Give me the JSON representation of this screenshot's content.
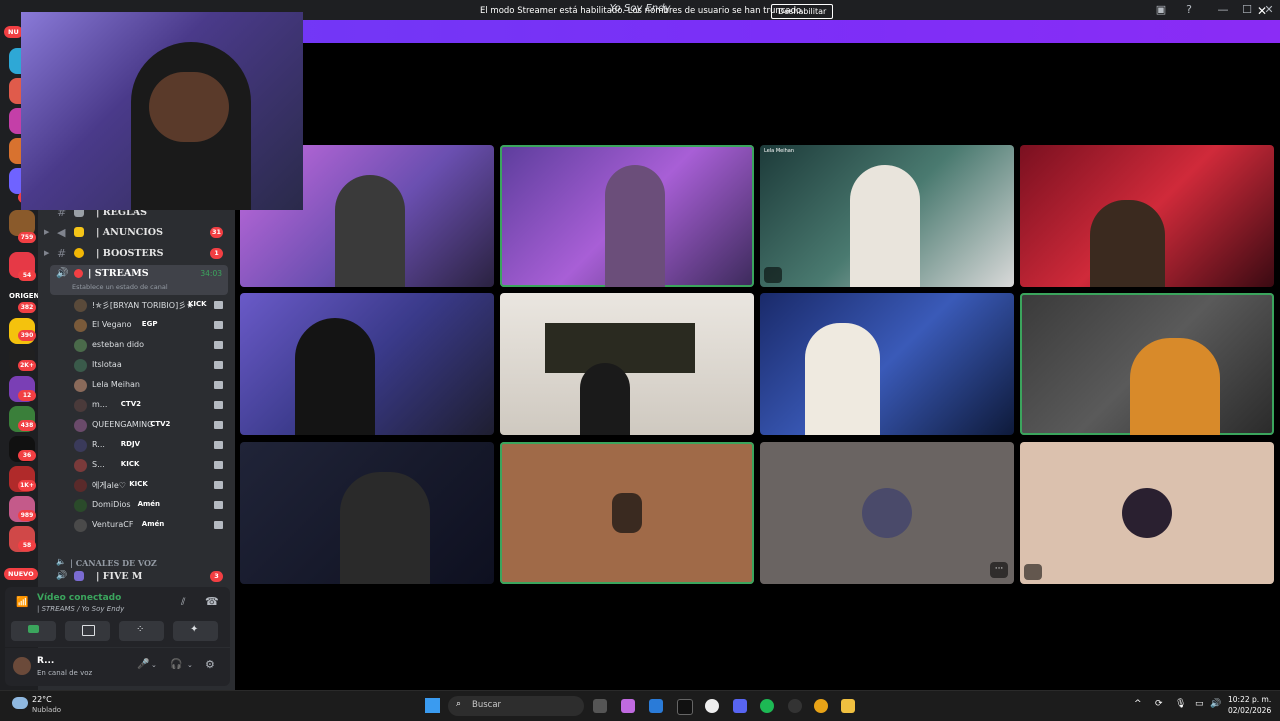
{
  "window": {
    "title": "Yo Soy Endy",
    "controls": [
      "—",
      "☐",
      "✕"
    ]
  },
  "banner": {
    "text": "El modo Streamer está habilitado. Los nombres de usuario se han truncado.",
    "button": "Deshabilitar",
    "close": "✕"
  },
  "rail": {
    "top_label": "NU",
    "badges": [
      "18",
      "759",
      "54",
      "382",
      "390",
      "2K+",
      "12",
      "438",
      "36",
      "1K+",
      "989",
      "58"
    ],
    "bottom_label": "NUEVO",
    "server_text": "ORIGEN"
  },
  "channels": [
    {
      "icon": "📋",
      "name": "| REGLAS",
      "badge": ""
    },
    {
      "icon": "🔔",
      "name": "| ANUNCIOS",
      "badge": "31"
    },
    {
      "icon": "🌟",
      "name": "| BOOSTERS",
      "badge": "1"
    }
  ],
  "streams_channel": {
    "name": "| STREAMS",
    "time": "34:03",
    "status": "Establece un estado de canal"
  },
  "users": [
    {
      "name": "!✯彡[BRYAN TORIBIO]彡★",
      "tag": "KICK",
      "tag_color": "#53fc18"
    },
    {
      "name": "El Vegano",
      "tag": "EGP",
      "tag_color": "#ff6b8a"
    },
    {
      "name": "esteban dido",
      "tag": "",
      "tag_color": ""
    },
    {
      "name": "Itslotaa",
      "tag": "",
      "tag_color": ""
    },
    {
      "name": "Lela Meihan",
      "tag": "",
      "tag_color": ""
    },
    {
      "name": "m...",
      "tag": "CTV2",
      "tag_color": "#ff6b8a"
    },
    {
      "name": "QUEENGAMING",
      "tag": "CTV2",
      "tag_color": "#ff6b8a"
    },
    {
      "name": "R...",
      "tag": "RDJV",
      "tag_color": "#53fc18"
    },
    {
      "name": "S...",
      "tag": "KICK",
      "tag_color": "#53fc18"
    },
    {
      "name": "에게ale♡",
      "tag": "KICK",
      "tag_color": "#53fc18"
    },
    {
      "name": "DomiDios",
      "tag": "Amén",
      "tag_color": "#ff5c5c"
    },
    {
      "name": "VenturaCF",
      "tag": "Amén",
      "tag_color": "#ff5c5c"
    }
  ],
  "voice_category": "| CANALES DE VOZ",
  "five_m": {
    "name": "| FIVE M",
    "badge": "3"
  },
  "voice_panel": {
    "status": "Vídeo conectado",
    "location": "| STREAMS / Yo Soy Endy"
  },
  "user_panel": {
    "name": "R...",
    "status": "En canal de voz"
  },
  "stage": {
    "tile_tag": "Lela Meihan",
    "more": "···"
  },
  "taskbar": {
    "weather_temp": "22°C",
    "weather_desc": "Nublado",
    "search": "Buscar",
    "time": "10:22 p. m.",
    "date": "02/02/2026"
  },
  "colors": {
    "banner": "#7b2ff7",
    "speaking": "#3ba55d",
    "badge": "#f23f43",
    "sidebar": "#2b2d31",
    "rail": "#1e1f22"
  }
}
